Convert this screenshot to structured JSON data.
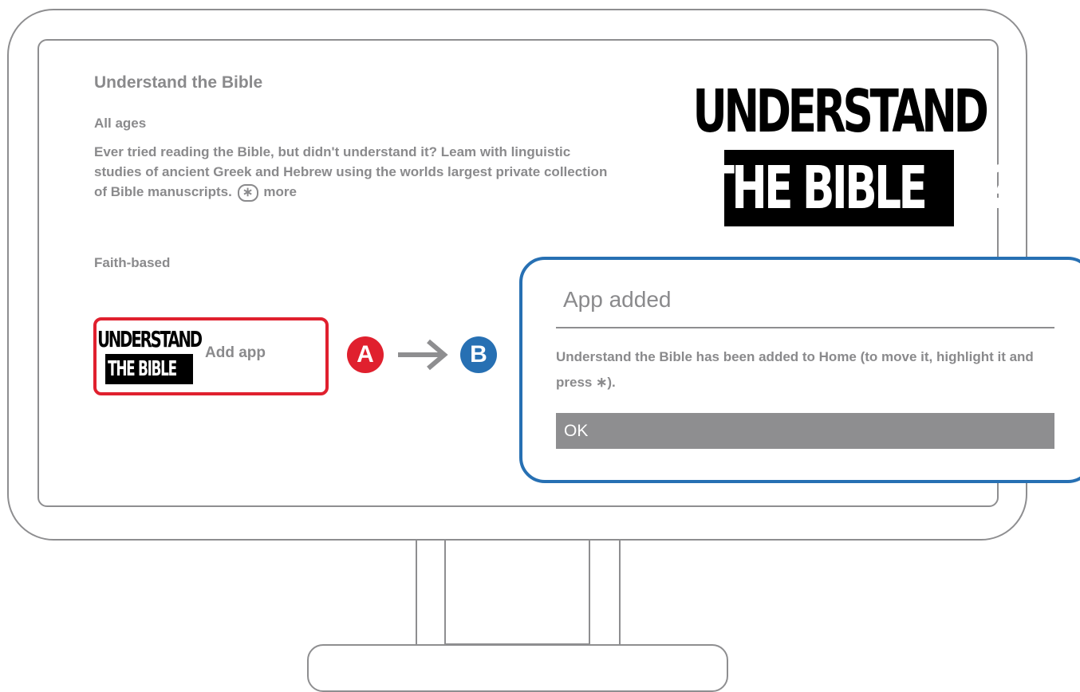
{
  "app": {
    "title": "Understand the Bible",
    "age_rating": "All ages",
    "description": "Ever tried reading the Bible, but didn't understand it? Leam with linguistic studies of ancient Greek and Hebrew using the worlds largest private collection of Bible manuscripts.",
    "more_label": "more",
    "more_icon": "star-circle-icon",
    "genre": "Faith-based",
    "logo": {
      "line1": "UNDERSTAND",
      "line2": "THE BIBLE",
      "suffix": ".com",
      "mark": "?"
    }
  },
  "add_app": {
    "label": "Add app"
  },
  "steps": {
    "a": "A",
    "b": "B",
    "arrow_icon": "right-arrow-icon"
  },
  "dialog": {
    "title": "App added",
    "message": "Understand the Bible has been added to Home (to move it, highlight it and press ∗).",
    "ok_label": "OK"
  },
  "colors": {
    "step_a": "#e0202e",
    "step_b": "#2770b3",
    "ui_gray": "#8e8e90"
  }
}
